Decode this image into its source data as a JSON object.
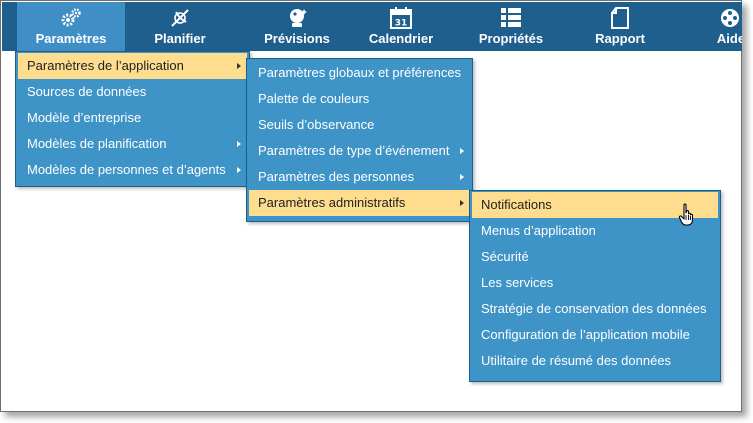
{
  "nav": {
    "items": [
      {
        "label": "Paramètres",
        "icon": "gears-icon"
      },
      {
        "label": "Planifier",
        "icon": "compass-icon"
      },
      {
        "label": "Prévisions",
        "icon": "crystal-ball-icon"
      },
      {
        "label": "Calendrier",
        "icon": "calendar-icon",
        "icon_text": "31"
      },
      {
        "label": "Propriétés",
        "icon": "list-icon"
      },
      {
        "label": "Rapport",
        "icon": "report-icon"
      },
      {
        "label": "Aide",
        "icon": "film-reel-icon"
      }
    ]
  },
  "menu_level1": {
    "items": [
      {
        "label": "Paramètres de l’application",
        "has_submenu": true,
        "highlighted": true
      },
      {
        "label": "Sources de données",
        "has_submenu": false
      },
      {
        "label": "Modèle d’entreprise",
        "has_submenu": false
      },
      {
        "label": "Modèles de planification",
        "has_submenu": true
      },
      {
        "label": "Modèles de personnes et d’agents",
        "has_submenu": true
      }
    ]
  },
  "menu_level2": {
    "items": [
      {
        "label": "Paramètres globaux et préférences",
        "has_submenu": false
      },
      {
        "label": "Palette de couleurs",
        "has_submenu": false
      },
      {
        "label": "Seuils d’observance",
        "has_submenu": false
      },
      {
        "label": "Paramètres de type d’événement",
        "has_submenu": true
      },
      {
        "label": "Paramètres des personnes",
        "has_submenu": true
      },
      {
        "label": "Paramètres administratifs",
        "has_submenu": true,
        "highlighted": true
      }
    ]
  },
  "menu_level3": {
    "items": [
      {
        "label": "Notifications",
        "highlighted": true
      },
      {
        "label": "Menus d’application"
      },
      {
        "label": "Sécurité"
      },
      {
        "label": "Les services"
      },
      {
        "label": "Stratégie de conservation des données"
      },
      {
        "label": "Configuration de l’application mobile"
      },
      {
        "label": "Utilitaire de résumé des données"
      }
    ]
  },
  "colors": {
    "nav_bg": "#1f5f8e",
    "nav_active": "#3f8fc6",
    "menu_bg": "#3e93c7",
    "highlight": "#fedd8e"
  }
}
